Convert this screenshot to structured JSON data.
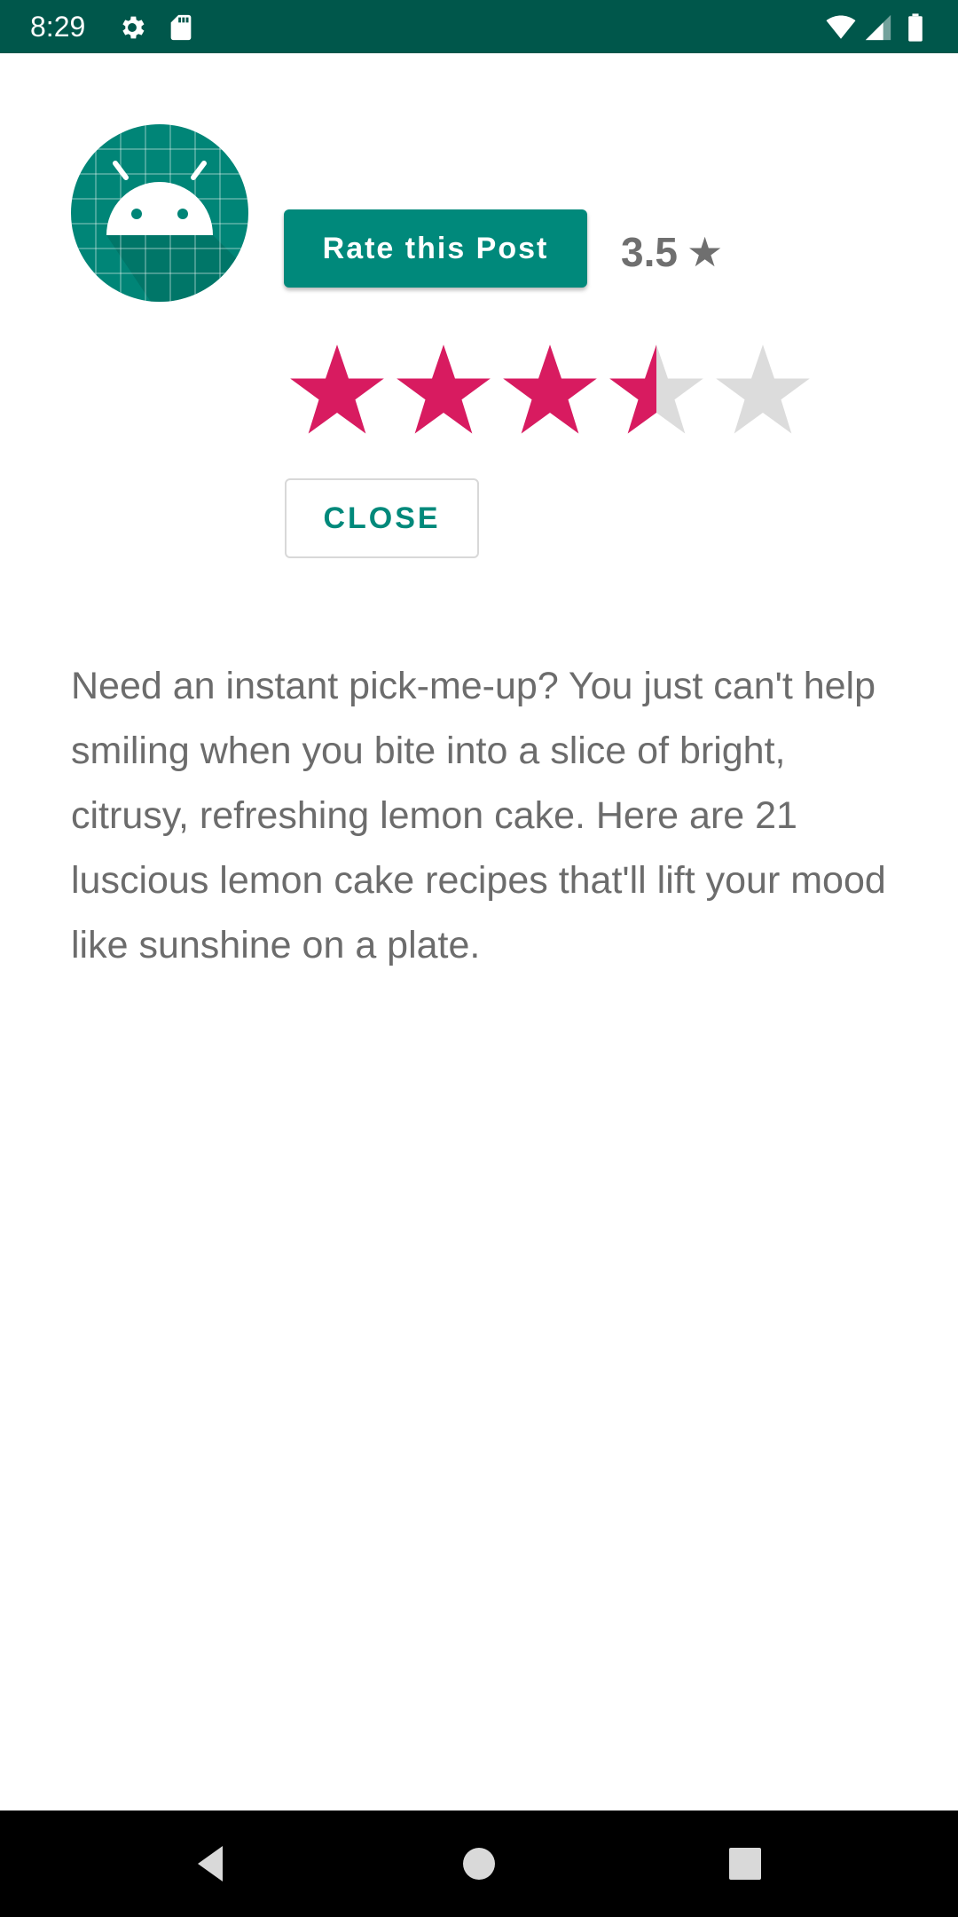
{
  "status_bar": {
    "time": "8:29",
    "icons": [
      "gear-icon",
      "sd-card-icon",
      "wifi-icon",
      "signal-icon",
      "battery-icon"
    ],
    "background": "#00574b"
  },
  "app": {
    "icon": "android-app-icon",
    "accent_color": "#00897b",
    "star_color": "#d81b60"
  },
  "rating": {
    "button_label": "Rate this Post",
    "value_text": "3.5",
    "star_glyph": "★",
    "value": 3.5,
    "max": 5
  },
  "close_button": {
    "label": "CLOSE"
  },
  "post": {
    "body": "Need an instant pick-me-up? You just can't help smiling when you bite into a slice of bright, citrusy, refreshing lemon cake. Here are 21 luscious lemon cake recipes that'll lift your mood like sunshine on a plate."
  },
  "nav_bar": {
    "buttons": [
      "back-icon",
      "home-icon",
      "recents-icon"
    ]
  }
}
